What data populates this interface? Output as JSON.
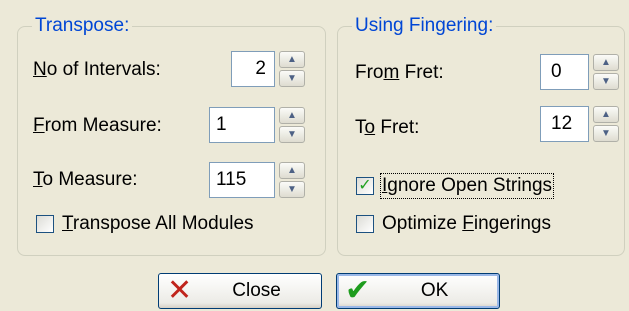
{
  "transpose": {
    "title": "Transpose:",
    "intervals": {
      "label_key": "N",
      "label_rest": "o of Intervals:",
      "value": "2"
    },
    "from_measure": {
      "label_key": "F",
      "label_rest": "rom Measure:",
      "value": "1"
    },
    "to_measure": {
      "label_key": "T",
      "label_rest": "o Measure:",
      "value": "115"
    },
    "all_modules": {
      "label_key": "T",
      "label_rest": "ranspose All Modules",
      "checked": false
    }
  },
  "fingering": {
    "title": "Using Fingering:",
    "from_fret": {
      "label_pre": "Fro",
      "label_key": "m",
      "label_rest": " Fret:",
      "value": "0"
    },
    "to_fret": {
      "label_pre": "T",
      "label_key": "o",
      "label_rest": " Fret:",
      "value": "12"
    },
    "ignore_open": {
      "label_key": "I",
      "label_rest": "gnore Open Strings",
      "checked": true
    },
    "optimize": {
      "label_pre": "Optimize ",
      "label_key": "F",
      "label_rest": "ingerings",
      "checked": false
    }
  },
  "buttons": {
    "close": {
      "label": "Close",
      "icon": "close-x-icon",
      "icon_color": "#c0241c"
    },
    "ok": {
      "label": "OK",
      "icon": "checkmark-icon",
      "icon_color": "#1e9c1e"
    }
  },
  "colors": {
    "group_title": "#0046d5",
    "background": "#ece9d8"
  }
}
